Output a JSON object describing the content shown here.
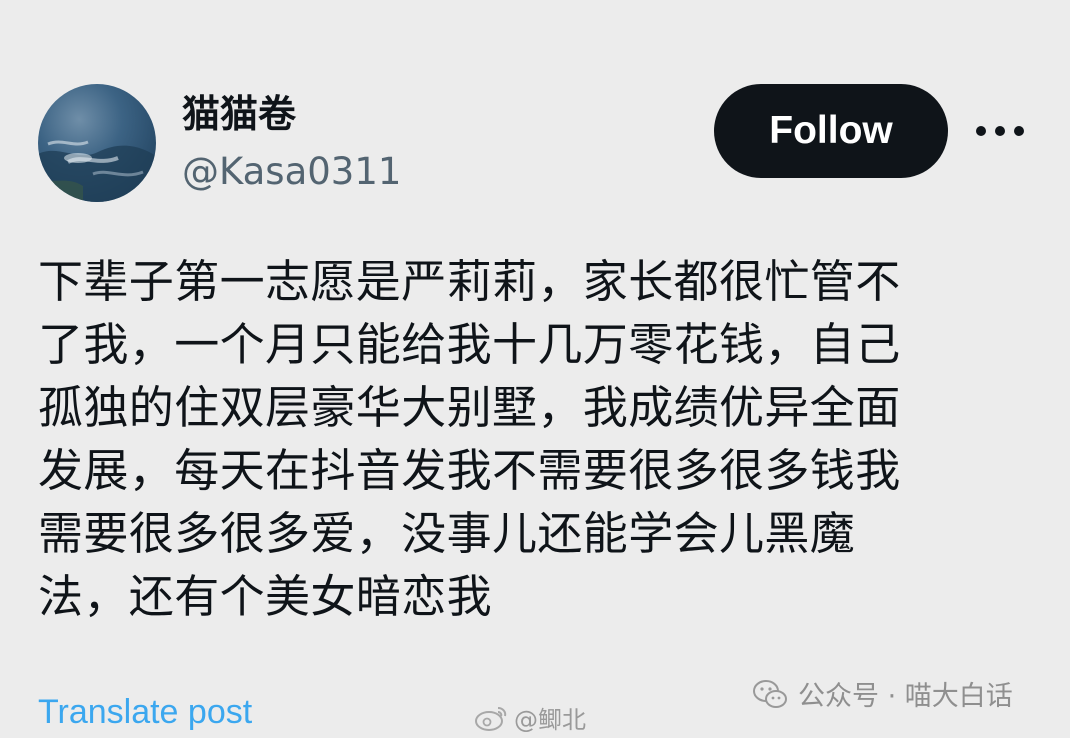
{
  "profile": {
    "display_name": "猫猫卷",
    "handle": "@Kasa0311"
  },
  "actions": {
    "follow_label": "Follow",
    "more_icon": "more-horizontal-icon"
  },
  "post": {
    "lines": [
      "下辈子第一志愿是严莉莉，家长都很忙管不",
      "了我，一个月只能给我十几万零花钱，自己",
      "孤独的住双层豪华大别墅，我成绩优异全面",
      "发展，每天在抖音发我不需要很多很多钱我",
      "需要很多很多爱，没事儿还能学会儿黑魔",
      "法，还有个美女暗恋我"
    ],
    "translate_label": "Translate post"
  },
  "watermarks": {
    "weibo_text": "@鲫北",
    "wechat_text": "公众号 · 喵大白话"
  },
  "colors": {
    "background": "#ececec",
    "text": "#0f1419",
    "secondary_text": "#536471",
    "follow_bg": "#0f1419",
    "link": "#1d9bf0"
  }
}
